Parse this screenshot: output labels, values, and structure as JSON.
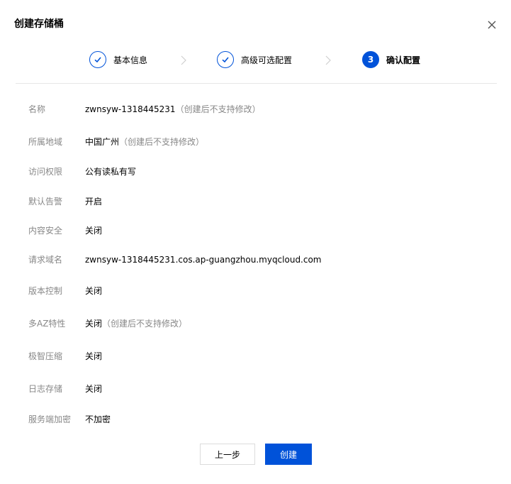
{
  "dialog": {
    "title": "创建存储桶",
    "close_icon": "close-icon"
  },
  "steps": [
    {
      "label": "基本信息",
      "state": "done"
    },
    {
      "label": "高级可选配置",
      "state": "done"
    },
    {
      "label": "确认配置",
      "state": "current",
      "number": "3"
    }
  ],
  "fields": [
    {
      "key": "名称",
      "value": "zwnsyw-1318445231",
      "note": "（创建后不支持修改）"
    },
    {
      "key": "所属地域",
      "value": "中国广州",
      "note": "（创建后不支持修改）"
    },
    {
      "key": "访问权限",
      "value": "公有读私有写"
    },
    {
      "key": "默认告警",
      "value": "开启"
    },
    {
      "key": "内容安全",
      "value": "关闭"
    },
    {
      "key": "请求域名",
      "value": "zwnsyw-1318445231.cos.ap-guangzhou.myqcloud.com"
    },
    {
      "key": "版本控制",
      "value": "关闭"
    },
    {
      "key": "多AZ特性",
      "value": "关闭",
      "note": "（创建后不支持修改）"
    },
    {
      "key": "极智压缩",
      "value": "关闭"
    },
    {
      "key": "日志存储",
      "value": "关闭"
    },
    {
      "key": "服务端加密",
      "value": "不加密"
    }
  ],
  "buttons": {
    "prev": "上一步",
    "create": "创建"
  },
  "colors": {
    "primary": "#0052d9",
    "muted": "#888888",
    "divider": "#e7e7e7"
  }
}
